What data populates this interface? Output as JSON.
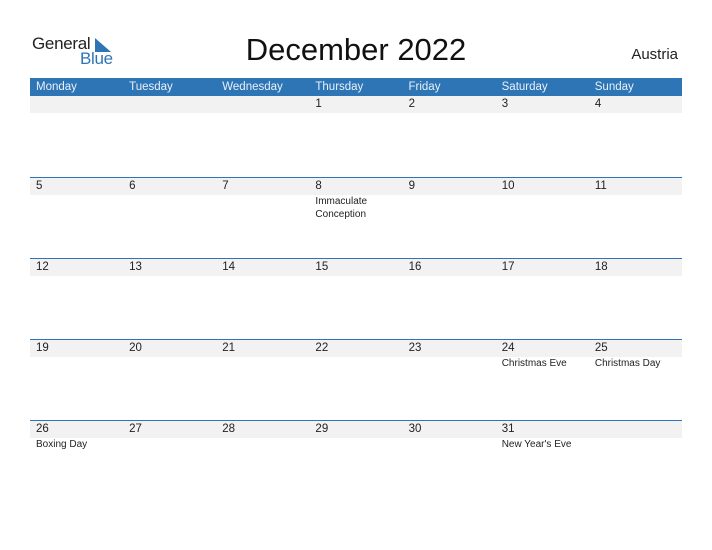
{
  "logo": {
    "word1": "General",
    "word2": "Blue",
    "icon": "triangle-flag-icon",
    "accent_color": "#2e75b6"
  },
  "title": "December 2022",
  "country": "Austria",
  "weekdays": [
    "Monday",
    "Tuesday",
    "Wednesday",
    "Thursday",
    "Friday",
    "Saturday",
    "Sunday"
  ],
  "weeks": [
    {
      "days": [
        {
          "date": "",
          "holiday": ""
        },
        {
          "date": "",
          "holiday": ""
        },
        {
          "date": "",
          "holiday": ""
        },
        {
          "date": "1",
          "holiday": ""
        },
        {
          "date": "2",
          "holiday": ""
        },
        {
          "date": "3",
          "holiday": ""
        },
        {
          "date": "4",
          "holiday": ""
        }
      ]
    },
    {
      "days": [
        {
          "date": "5",
          "holiday": ""
        },
        {
          "date": "6",
          "holiday": ""
        },
        {
          "date": "7",
          "holiday": ""
        },
        {
          "date": "8",
          "holiday": "Immaculate Conception"
        },
        {
          "date": "9",
          "holiday": ""
        },
        {
          "date": "10",
          "holiday": ""
        },
        {
          "date": "11",
          "holiday": ""
        }
      ]
    },
    {
      "days": [
        {
          "date": "12",
          "holiday": ""
        },
        {
          "date": "13",
          "holiday": ""
        },
        {
          "date": "14",
          "holiday": ""
        },
        {
          "date": "15",
          "holiday": ""
        },
        {
          "date": "16",
          "holiday": ""
        },
        {
          "date": "17",
          "holiday": ""
        },
        {
          "date": "18",
          "holiday": ""
        }
      ]
    },
    {
      "days": [
        {
          "date": "19",
          "holiday": ""
        },
        {
          "date": "20",
          "holiday": ""
        },
        {
          "date": "21",
          "holiday": ""
        },
        {
          "date": "22",
          "holiday": ""
        },
        {
          "date": "23",
          "holiday": ""
        },
        {
          "date": "24",
          "holiday": "Christmas Eve"
        },
        {
          "date": "25",
          "holiday": "Christmas Day"
        }
      ]
    },
    {
      "days": [
        {
          "date": "26",
          "holiday": "Boxing Day"
        },
        {
          "date": "27",
          "holiday": ""
        },
        {
          "date": "28",
          "holiday": ""
        },
        {
          "date": "29",
          "holiday": ""
        },
        {
          "date": "30",
          "holiday": ""
        },
        {
          "date": "31",
          "holiday": "New Year's Eve"
        },
        {
          "date": "",
          "holiday": ""
        }
      ]
    }
  ]
}
